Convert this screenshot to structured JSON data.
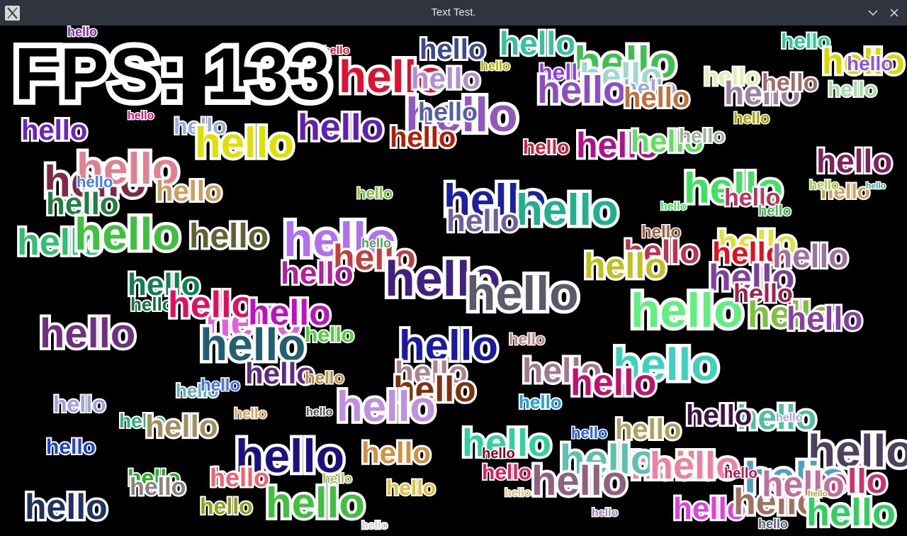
{
  "window": {
    "title": "Text Test.",
    "app_icon": "x-app-icon",
    "controls": [
      "chevron-down-icon",
      "close-icon"
    ]
  },
  "overlay": {
    "fps_text": "FPS: 133"
  },
  "words": [
    {
      "t": "hello",
      "c": "#7b2ab8"
    },
    {
      "t": "hello",
      "c": "#e01030"
    },
    {
      "t": "hello",
      "c": "#3a4a8c"
    },
    {
      "t": "hello",
      "c": "#38c0a0"
    },
    {
      "t": "hello",
      "c": "#40c050"
    },
    {
      "t": "hello",
      "c": "#2cc89a"
    },
    {
      "t": "hello",
      "c": "#d8d800"
    },
    {
      "t": "hello",
      "c": "#9050e0"
    },
    {
      "t": "hello",
      "c": "#e01030"
    },
    {
      "t": "hello",
      "c": "#b090d0"
    },
    {
      "t": "hello",
      "c": "#9040e0"
    },
    {
      "t": "hello",
      "c": "#a0d8d0"
    },
    {
      "t": "hello",
      "c": "#b0b000"
    },
    {
      "t": "hello",
      "c": "#8a50c0"
    },
    {
      "t": "hello",
      "c": "#e0f0b0"
    },
    {
      "t": "hello",
      "c": "#a080a0"
    },
    {
      "t": "hello",
      "c": "#a0a8d8"
    },
    {
      "t": "hello",
      "c": "#c0703a"
    },
    {
      "t": "hello",
      "c": "#a06a6a"
    },
    {
      "t": "hello",
      "c": "#b0a000"
    },
    {
      "t": "hello",
      "c": "#a0e0a0"
    },
    {
      "t": "hello",
      "c": "#7020c0"
    },
    {
      "t": "hello",
      "c": "#d01080"
    },
    {
      "t": "hello",
      "c": "#90b0e0"
    },
    {
      "t": "hello",
      "c": "#e0e000"
    },
    {
      "t": "hello",
      "c": "#6020b0"
    },
    {
      "t": "hello",
      "c": "#9058c0"
    },
    {
      "t": "hello",
      "c": "#5060a0"
    },
    {
      "t": "hello",
      "c": "#b02000"
    },
    {
      "t": "hello",
      "c": "#d02040"
    },
    {
      "t": "hello",
      "c": "#b01090"
    },
    {
      "t": "hello",
      "c": "#60e060"
    },
    {
      "t": "hello",
      "c": "#a0b0a0"
    },
    {
      "t": "hello",
      "c": "#802060"
    },
    {
      "t": "hello",
      "c": "#802848"
    },
    {
      "t": "hello",
      "c": "#e08090"
    },
    {
      "t": "hello",
      "c": "#4080f0"
    },
    {
      "t": "hello",
      "c": "#c8a060"
    },
    {
      "t": "hello",
      "c": "#208040"
    },
    {
      "t": "hello",
      "c": "#80c040"
    },
    {
      "t": "hello",
      "c": "#30c070"
    },
    {
      "t": "hello",
      "c": "#40c040"
    },
    {
      "t": "hello",
      "c": "#606030"
    },
    {
      "t": "hello",
      "c": "#b070f0"
    },
    {
      "t": "hello",
      "c": "#c04040"
    },
    {
      "t": "hello",
      "c": "#1a20a0"
    },
    {
      "t": "hello",
      "c": "#20b090"
    },
    {
      "t": "hello",
      "c": "#7060a0"
    },
    {
      "t": "hello",
      "c": "#c03050"
    },
    {
      "t": "hello",
      "c": "#a06040"
    },
    {
      "t": "hello",
      "c": "#e0e040"
    },
    {
      "t": "hello",
      "c": "#40e060"
    },
    {
      "t": "hello",
      "c": "#c03060"
    },
    {
      "t": "hello",
      "c": "#e01020"
    },
    {
      "t": "hello",
      "c": "#a070a0"
    },
    {
      "t": "hello",
      "c": "#d0a060"
    },
    {
      "t": "hello",
      "c": "#a0d040"
    },
    {
      "t": "hello",
      "c": "#40a0a0"
    },
    {
      "t": "hello",
      "c": "#40e060"
    },
    {
      "t": "hello",
      "c": "#40c050"
    },
    {
      "t": "hello",
      "c": "#c0c020"
    },
    {
      "t": "hello",
      "c": "#8040a0"
    },
    {
      "t": "hello",
      "c": "#60f080"
    },
    {
      "t": "hello",
      "c": "#a02050"
    },
    {
      "t": "hello",
      "c": "#b020a0"
    },
    {
      "t": "hello",
      "c": "#50a060"
    },
    {
      "t": "hello",
      "c": "#108050"
    },
    {
      "t": "hello",
      "c": "#402080"
    },
    {
      "t": "hello",
      "c": "#5a5a6a"
    },
    {
      "t": "hello",
      "c": "#80c040"
    },
    {
      "t": "hello",
      "c": "#8840a0"
    },
    {
      "t": "hello",
      "c": "#e060e0"
    },
    {
      "t": "hello",
      "c": "#107040"
    },
    {
      "t": "hello",
      "c": "#6040c0"
    },
    {
      "t": "hello",
      "c": "#e01060"
    },
    {
      "t": "hello",
      "c": "#c010c0"
    },
    {
      "t": "hello",
      "c": "#50d040"
    },
    {
      "t": "hello",
      "c": "#703080"
    },
    {
      "t": "hello",
      "c": "#206070"
    },
    {
      "t": "hello",
      "c": "#1a1aa0"
    },
    {
      "t": "hello",
      "c": "#c08080"
    },
    {
      "t": "hello",
      "c": "#b08090"
    },
    {
      "t": "hello",
      "c": "#40d0c0"
    },
    {
      "t": "hello",
      "c": "#602880"
    },
    {
      "t": "hello",
      "c": "#c09040"
    },
    {
      "t": "hello",
      "c": "#a07890"
    },
    {
      "t": "hello",
      "c": "#803010"
    },
    {
      "t": "hello",
      "c": "#c01070"
    },
    {
      "t": "hello",
      "c": "#50c0a0"
    },
    {
      "t": "hello",
      "c": "#a0a0e0"
    },
    {
      "t": "hello",
      "c": "#60b0c0"
    },
    {
      "t": "hello",
      "c": "#4070f0"
    },
    {
      "t": "hello",
      "c": "#c090e0"
    },
    {
      "t": "hello",
      "c": "#e0a060"
    },
    {
      "t": "hello",
      "c": "#505050"
    },
    {
      "t": "hello",
      "c": "#20a0e0"
    },
    {
      "t": "hello",
      "c": "#401040"
    },
    {
      "t": "hello",
      "c": "#30b080"
    },
    {
      "t": "hello",
      "c": "#a09060"
    },
    {
      "t": "hello",
      "c": "#b0a0e0"
    },
    {
      "t": "hello",
      "c": "#1a1080"
    },
    {
      "t": "hello",
      "c": "#d09040"
    },
    {
      "t": "hello",
      "c": "#30d0a0"
    },
    {
      "t": "hello",
      "c": "#900020"
    },
    {
      "t": "hello",
      "c": "#2040d0"
    },
    {
      "t": "hello",
      "c": "#20b020"
    },
    {
      "t": "hello",
      "c": "#103080"
    },
    {
      "t": "hello",
      "c": "#e09080"
    },
    {
      "t": "hello",
      "c": "#60c0b0"
    },
    {
      "t": "hello",
      "c": "#2860f0"
    },
    {
      "t": "hello",
      "c": "#b0a060"
    },
    {
      "t": "hello",
      "c": "#f080a0"
    },
    {
      "t": "hello",
      "c": "#504060"
    },
    {
      "t": "hello",
      "c": "#908080"
    },
    {
      "t": "hello",
      "c": "#f06070"
    },
    {
      "t": "hello",
      "c": "#c07010"
    },
    {
      "t": "hello",
      "c": "#e0c040"
    },
    {
      "t": "hello",
      "c": "#203060"
    },
    {
      "t": "hello",
      "c": "#90a020"
    },
    {
      "t": "hello",
      "c": "#40c040"
    },
    {
      "t": "hello",
      "c": "#e0c080"
    },
    {
      "t": "hello",
      "c": "#a080c0"
    },
    {
      "t": "hello",
      "c": "#906080"
    },
    {
      "t": "hello",
      "c": "#e040e0"
    },
    {
      "t": "hello",
      "c": "#50a0c0"
    },
    {
      "t": "hello",
      "c": "#d03070"
    },
    {
      "t": "hello",
      "c": "#a07060"
    },
    {
      "t": "hello",
      "c": "#c070a0"
    },
    {
      "t": "hello",
      "c": "#30d060"
    },
    {
      "t": "hello",
      "c": "#c01050"
    },
    {
      "t": "hello",
      "c": "#506080"
    },
    {
      "t": "hello",
      "c": "#c0a040"
    },
    {
      "t": "hello",
      "c": "#d0d0d0"
    },
    {
      "t": "hello",
      "c": "#a0c060"
    },
    {
      "t": "hello",
      "c": "#e02060"
    }
  ]
}
